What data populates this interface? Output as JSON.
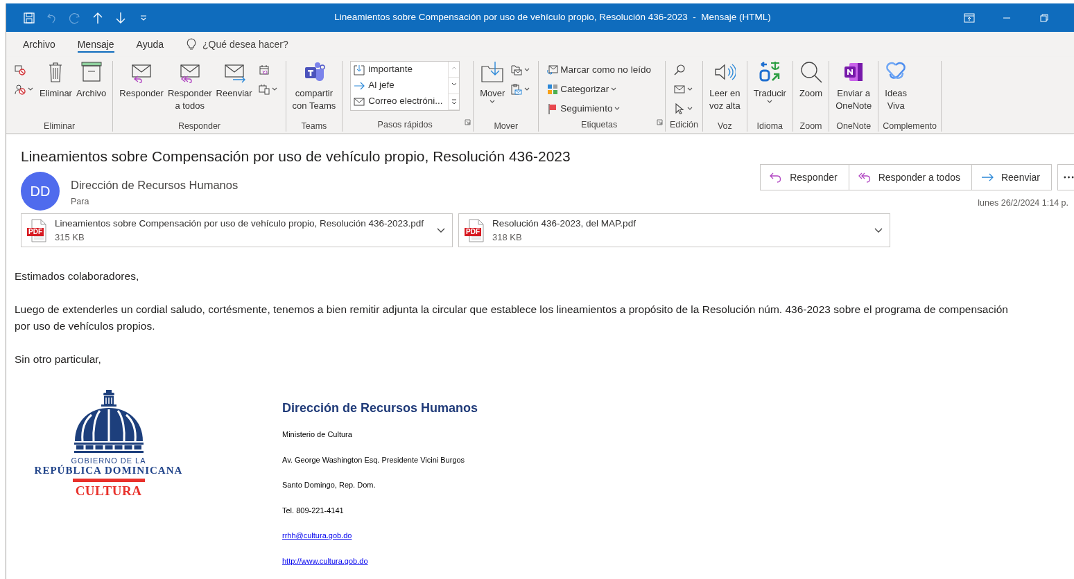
{
  "window": {
    "title": "Lineamientos sobre Compensación por uso de vehículo propio, Resolución 436-2023  -  Mensaje (HTML)"
  },
  "quick_access": [
    {
      "disabled": false
    },
    {
      "disabled": true
    },
    {
      "disabled": true
    },
    {
      "disabled": false
    },
    {
      "disabled": false
    },
    {
      "disabled": false
    }
  ],
  "menu_tabs": [
    {
      "label": "Archivo",
      "selected": false
    },
    {
      "label": "Mensaje",
      "selected": true
    },
    {
      "label": "Ayuda",
      "selected": false
    }
  ],
  "tell_me": {
    "placeholder": "¿Qué desea hacer?"
  },
  "ribbon": [
    {
      "label": "Eliminar",
      "launcher": false,
      "items": [
        {
          "kind": "stack",
          "commands": [
            {
              "caret": false
            },
            {
              "caret": true
            }
          ]
        },
        {
          "kind": "large",
          "lines": [
            "Eliminar"
          ],
          "caret": false
        },
        {
          "kind": "large",
          "lines": [
            "Archivo"
          ],
          "caret": false
        }
      ]
    },
    {
      "label": "Responder",
      "launcher": false,
      "items": [
        {
          "kind": "large",
          "lines": [
            "Responder"
          ],
          "caret": false
        },
        {
          "kind": "large",
          "lines": [
            "Responder",
            "a todos"
          ],
          "caret": false
        },
        {
          "kind": "large",
          "lines": [
            "Reenviar"
          ],
          "caret": false
        },
        {
          "kind": "stack",
          "commands": [
            {
              "caret": false
            },
            {
              "caret": true
            }
          ]
        }
      ]
    },
    {
      "label": "Teams",
      "launcher": false,
      "items": [
        {
          "kind": "large",
          "lines": [
            "compartir",
            "con Teams"
          ],
          "caret": false
        }
      ]
    },
    {
      "label": "Pasos rápidos",
      "launcher": true,
      "items": [
        {
          "kind": "gallery",
          "entries": [
            "importante",
            "Al jefe",
            "Correo electróni..."
          ]
        }
      ]
    },
    {
      "label": "Mover",
      "launcher": false,
      "items": [
        {
          "kind": "large",
          "lines": [
            "Mover"
          ],
          "caret": true
        },
        {
          "kind": "stack",
          "commands": [
            {
              "caret": true
            },
            {
              "caret": true
            }
          ]
        }
      ]
    },
    {
      "label": "Etiquetas",
      "launcher": true,
      "items": [
        {
          "kind": "stack",
          "commands": [
            {
              "label": "Marcar como no leído",
              "caret": false
            },
            {
              "label": "Categorizar",
              "caret": true
            },
            {
              "label": "Seguimiento",
              "caret": true
            }
          ]
        }
      ]
    },
    {
      "label": "Edición",
      "launcher": false,
      "items": [
        {
          "kind": "stack",
          "commands": [
            {
              "caret": false
            },
            {
              "caret": true
            },
            {
              "caret": true
            }
          ]
        }
      ]
    },
    {
      "label": "Voz",
      "launcher": false,
      "items": [
        {
          "kind": "large",
          "lines": [
            "Leer en",
            "voz alta"
          ],
          "caret": false
        }
      ]
    },
    {
      "label": "Idioma",
      "launcher": false,
      "items": [
        {
          "kind": "large",
          "lines": [
            "Traducir"
          ],
          "caret": true
        }
      ]
    },
    {
      "label": "Zoom",
      "launcher": false,
      "items": [
        {
          "kind": "large",
          "lines": [
            "Zoom"
          ],
          "caret": false
        }
      ]
    },
    {
      "label": "OneNote",
      "launcher": false,
      "items": [
        {
          "kind": "large",
          "lines": [
            "Enviar a",
            "OneNote"
          ],
          "caret": false
        }
      ]
    },
    {
      "label": "Complemento",
      "launcher": false,
      "items": [
        {
          "kind": "large",
          "lines": [
            "Ideas",
            "Viva"
          ],
          "caret": false
        }
      ]
    }
  ],
  "message": {
    "subject": "Lineamientos sobre Compensación por uso de vehículo propio, Resolución 436-2023",
    "sender": {
      "initials": "DD",
      "name": "Dirección de Recursos Humanos",
      "to_label": "Para"
    },
    "actions": [
      "Responder",
      "Responder a todos",
      "Reenviar"
    ],
    "date": "lunes 26/2/2024 1:14 p.",
    "attachments": [
      {
        "name": "Lineamientos sobre Compensación por uso de vehículo propio, Resolución 436-2023.pdf",
        "size": "315 KB",
        "badge": "PDF"
      },
      {
        "name": "Resolución 436-2023, del MAP.pdf",
        "size": "318 KB",
        "badge": "PDF"
      }
    ],
    "body": [
      "Estimados colaboradores,",
      "Luego de extenderles un cordial saludo, cortésmente, tenemos a bien remitir adjunta la circular que establece los lineamientos a propósito de la Resolución núm. 436-2023 sobre el programa de compensación por uso de vehículos propios.",
      "Sin otro particular,"
    ],
    "signature": {
      "logo": {
        "line_1": "GOBIERNO DE LA",
        "line_2": "REPÚBLICA DOMINICANA",
        "line_3": "CULTURA"
      },
      "heading": "Dirección de Recursos Humanos",
      "lines": [
        {
          "kind": "text",
          "text": "Ministerio de Cultura"
        },
        {
          "kind": "text",
          "text": "Av. George Washington Esq. Presidente Vicini Burgos"
        },
        {
          "kind": "text",
          "text": "Santo Domingo, Rep. Dom."
        },
        {
          "kind": "text",
          "text": "Tel. 809-221-4141"
        },
        {
          "kind": "link",
          "text": "rrhh@cultura.gob.do"
        },
        {
          "kind": "link",
          "text": "http://www.cultura.gob.do"
        }
      ]
    }
  }
}
